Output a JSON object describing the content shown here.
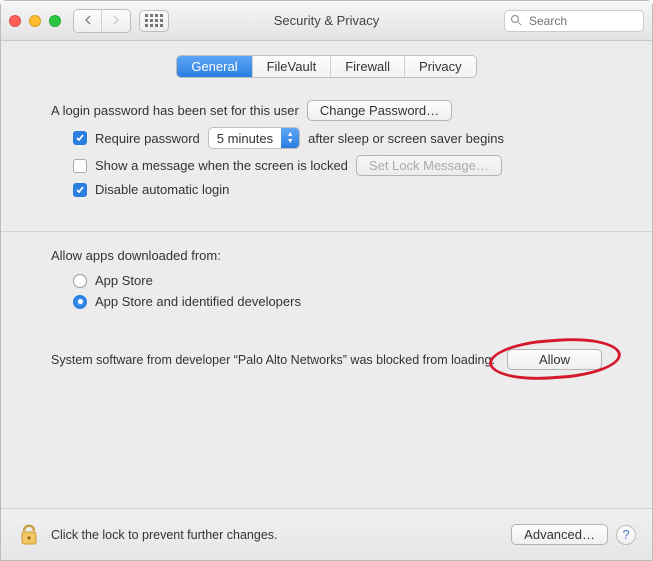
{
  "window": {
    "title": "Security & Privacy"
  },
  "search": {
    "placeholder": "Search"
  },
  "tabs": [
    {
      "label": "General",
      "active": true
    },
    {
      "label": "FileVault",
      "active": false
    },
    {
      "label": "Firewall",
      "active": false
    },
    {
      "label": "Privacy",
      "active": false
    }
  ],
  "login": {
    "set_text": "A login password has been set for this user",
    "change_btn": "Change Password…",
    "require_pw_label": "Require password",
    "require_pw_checked": true,
    "delay_value": "5 minutes",
    "after_text": "after sleep or screen saver begins",
    "show_msg_label": "Show a message when the screen is locked",
    "show_msg_checked": false,
    "set_lock_btn": "Set Lock Message…",
    "disable_auto_label": "Disable automatic login",
    "disable_auto_checked": true
  },
  "allow_apps": {
    "heading": "Allow apps downloaded from:",
    "opt1": "App Store",
    "opt2": "App Store and identified developers",
    "selected": 1
  },
  "blocked": {
    "text": "System software from developer “Palo Alto Networks” was blocked from loading.",
    "allow_btn": "Allow"
  },
  "footer": {
    "lock_text": "Click the lock to prevent further changes.",
    "advanced_btn": "Advanced…",
    "help_btn": "?"
  }
}
